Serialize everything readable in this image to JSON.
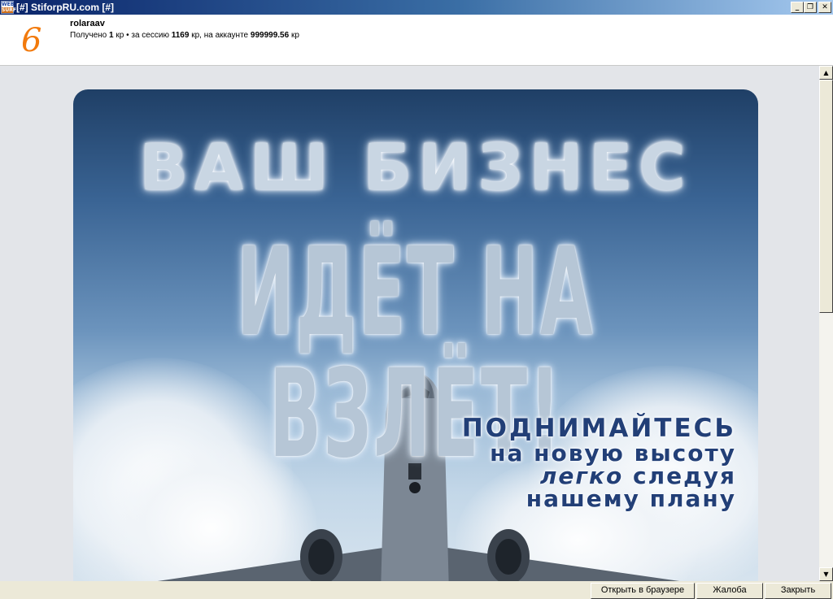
{
  "window": {
    "title": "[#] StiforpRU.com [#]",
    "app_icon_line1": "WEB",
    "app_icon_line2": "SURF",
    "controls": {
      "minimize": "_",
      "maximize": "❐",
      "close": "✕"
    }
  },
  "header": {
    "counter": "6",
    "username": "rolaraav",
    "stats": {
      "received_label": "Получено",
      "received_value": "1",
      "received_unit": "кр",
      "separator": "•",
      "session_label": "за сессию",
      "session_value": "1169",
      "session_unit": "кр,",
      "account_label": "на аккаунте",
      "account_value": "999999.56",
      "account_unit": "кр"
    }
  },
  "banner": {
    "headline_line1": "ВАШ БИЗНЕС",
    "headline_line2": "ИДЁТ НА ВЗЛЁТ!",
    "slogan_line1": "ПОДНИМАЙТЕСЬ",
    "slogan_line2": "на новую высоту",
    "slogan_line3_emph": "легко",
    "slogan_line3_rest": "следуя",
    "slogan_line4": "нашему плану"
  },
  "scrollbar": {
    "up_arrow": "▲",
    "down_arrow": "▼"
  },
  "footer": {
    "open_in_browser": "Открыть в браузере",
    "complain": "Жалоба",
    "close": "Закрыть"
  },
  "colors": {
    "title_bar_start": "#0a246a",
    "counter": "#f27a0c",
    "slogan": "#223f77"
  }
}
